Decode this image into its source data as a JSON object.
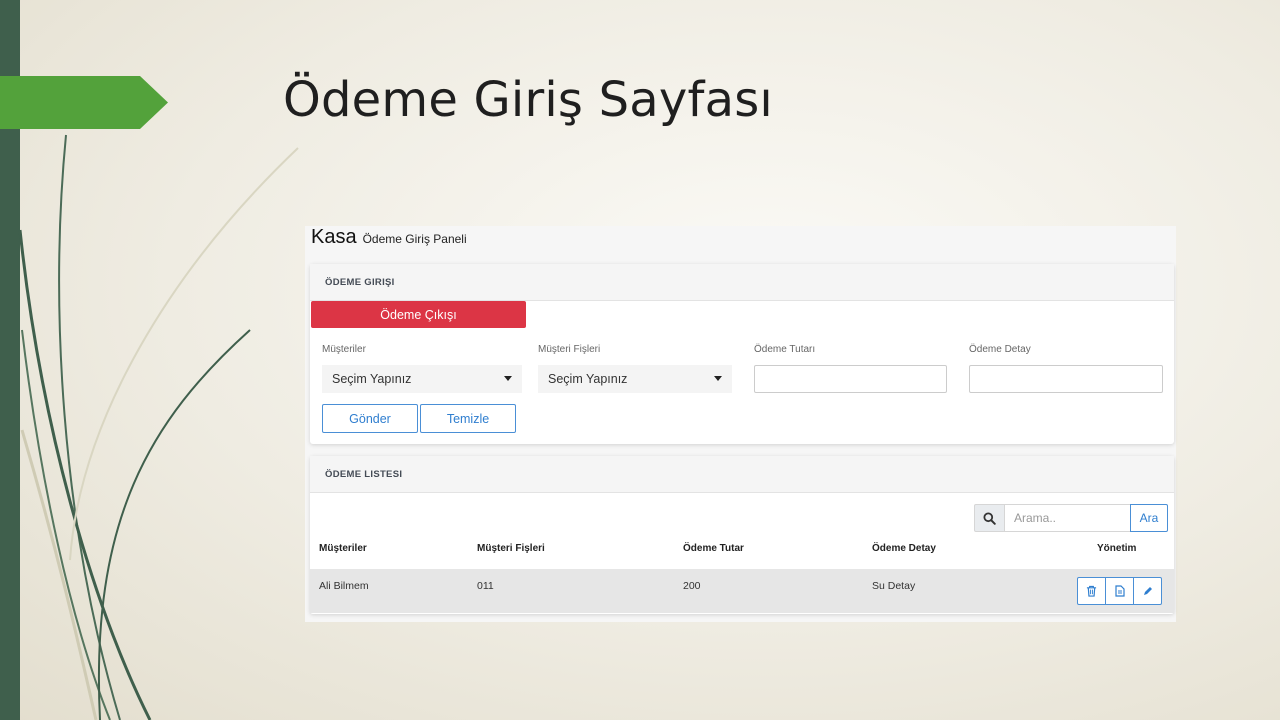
{
  "slide": {
    "title": "Ödeme Giriş Sayfası"
  },
  "app": {
    "title": "Kasa",
    "subtitle": "Ödeme Giriş Paneli"
  },
  "entry_panel": {
    "header": "ÖDEME GIRIŞI",
    "payment_out_button": "Ödeme Çıkışı",
    "fields": {
      "customers_label": "Müşteriler",
      "customers_value": "Seçim Yapınız",
      "receipts_label": "Müşteri Fişleri",
      "receipts_value": "Seçim Yapınız",
      "amount_label": "Ödeme Tutarı",
      "amount_value": "",
      "detail_label": "Ödeme Detay",
      "detail_value": ""
    },
    "submit_button": "Gönder",
    "clear_button": "Temizle"
  },
  "list_panel": {
    "header": "ÖDEME LISTESI",
    "search": {
      "placeholder": "Arama..",
      "button": "Ara"
    },
    "columns": [
      "Müşteriler",
      "Müşteri Fişleri",
      "Ödeme Tutar",
      "Ödeme Detay",
      "Yönetim"
    ],
    "rows": [
      {
        "customer": "Ali Bilmem",
        "receipt": "011",
        "amount": "200",
        "detail": "Su Detay"
      }
    ]
  },
  "icons": {
    "search": "search-icon",
    "delete": "trash-icon",
    "view": "document-icon",
    "edit": "pencil-icon"
  },
  "colors": {
    "accent_red": "#dc3545",
    "accent_blue": "#2f7ecf",
    "arrow_green": "#53a23b",
    "left_bar": "#3f5f4c"
  }
}
